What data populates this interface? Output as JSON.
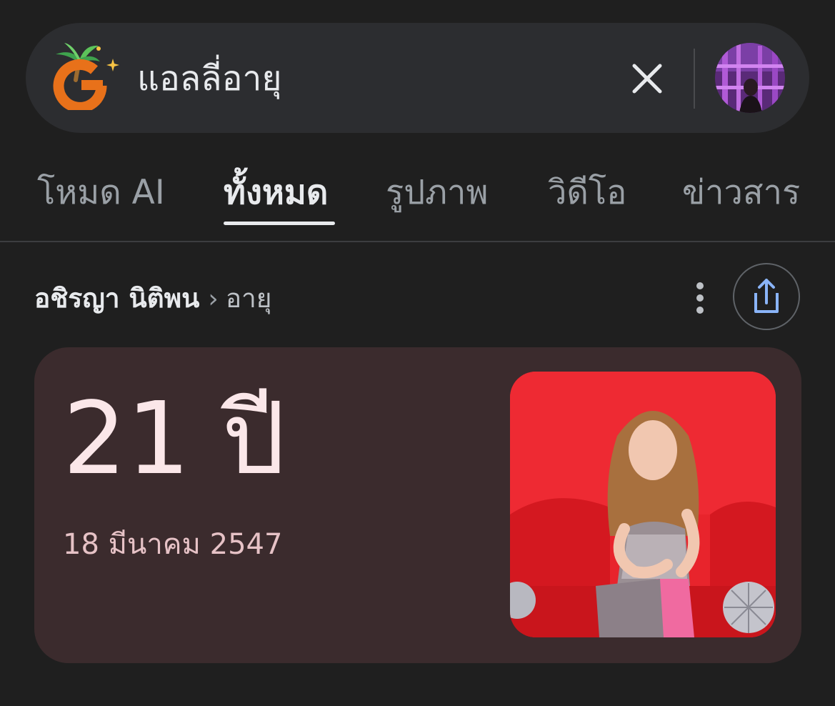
{
  "search": {
    "query": "แอลลี่อายุ",
    "logo_icon": "google-g-palm-tree-doodle",
    "clear_icon": "close-icon",
    "avatar_icon": "user-avatar"
  },
  "tabs": [
    {
      "label": "โหมด AI",
      "active": false
    },
    {
      "label": "ทั้งหมด",
      "active": true
    },
    {
      "label": "รูปภาพ",
      "active": false
    },
    {
      "label": "วิดีโอ",
      "active": false
    },
    {
      "label": "ข่าวสาร",
      "active": false
    }
  ],
  "breadcrumb": {
    "entity": "อชิรญา นิติพน",
    "separator": "›",
    "attribute": "อายุ"
  },
  "answer": {
    "age": "21 ปี",
    "birth_date": "18 มีนาคม 2547",
    "photo_icon": "person-photo"
  },
  "colors": {
    "background": "#1f1f1f",
    "search_bar": "#2c2d30",
    "card": "#3b2b2d",
    "age_text": "#fbe7e9",
    "date_text": "#e6c2c6",
    "share_icon": "#8ab4f8"
  }
}
